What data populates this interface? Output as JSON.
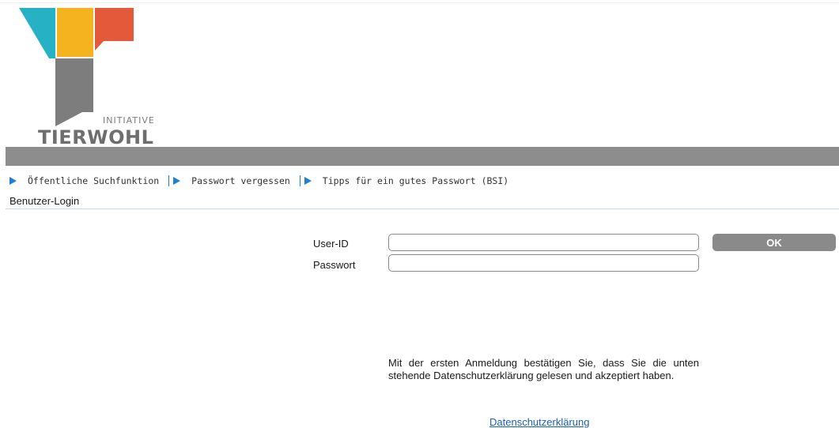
{
  "logo": {
    "line1": "INITIATIVE",
    "line2": "TIERWOHL",
    "colors": {
      "teal": "#27b1c4",
      "yellow": "#f5b31f",
      "red": "#e3593a",
      "grey": "#7d7d7d"
    }
  },
  "nav": {
    "items": [
      {
        "label": "Öffentliche Suchfunktion"
      },
      {
        "label": "Passwort vergessen"
      },
      {
        "label": "Tipps für ein gutes Passwort (BSI)"
      }
    ],
    "arrow_color": "#1e7fd6"
  },
  "section": {
    "title": "Benutzer-Login"
  },
  "login": {
    "user_label": "User-ID",
    "user_value": "",
    "password_label": "Passwort",
    "password_value": "",
    "ok_label": "OK"
  },
  "notice": {
    "text": "Mit der ersten Anmeldung bestätigen Sie, dass Sie die unten stehende Datenschutzerklärung gelesen und akzeptiert haben."
  },
  "footer": {
    "privacy_link": "Datenschutzerklärung"
  }
}
